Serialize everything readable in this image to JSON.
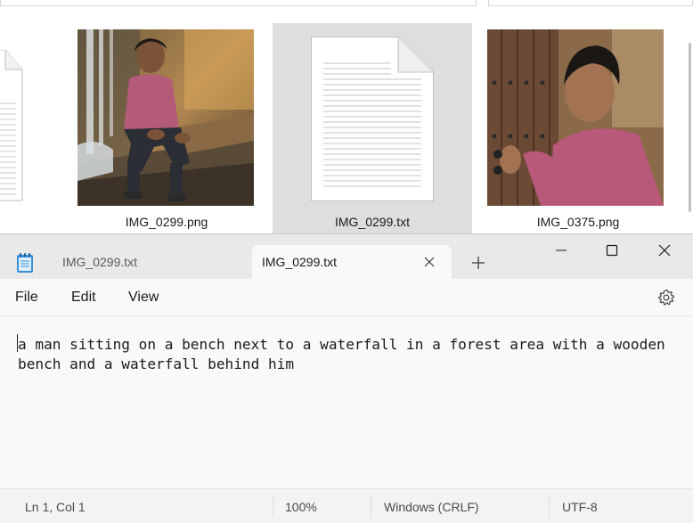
{
  "explorer": {
    "files": [
      {
        "name": "",
        "type": "txt",
        "thumbnail": "doc-icon-partial"
      },
      {
        "name": "IMG_0299.png",
        "type": "png",
        "thumbnail": "photo-man-bench-waterfall"
      },
      {
        "name": "IMG_0299.txt",
        "type": "txt",
        "thumbnail": "doc-icon",
        "selected": true
      },
      {
        "name": "IMG_0375.png",
        "type": "png",
        "thumbnail": "photo-man-wooden-door"
      }
    ]
  },
  "notepad": {
    "app_icon": "notepad-icon",
    "tabs": [
      {
        "label": "IMG_0299.txt",
        "active": false
      },
      {
        "label": "IMG_0299.txt",
        "active": true
      }
    ],
    "new_tab_icon": "plus-icon",
    "window_controls": [
      "minimize-icon",
      "maximize-icon",
      "close-icon"
    ],
    "menu": {
      "file": "File",
      "edit": "Edit",
      "view": "View"
    },
    "settings_icon": "gear-icon",
    "content": "a man sitting on a bench next to a waterfall in a forest area with a wooden bench and a waterfall behind him",
    "status": {
      "position": "Ln 1, Col 1",
      "zoom": "100%",
      "line_ending": "Windows (CRLF)",
      "encoding": "UTF-8"
    }
  },
  "colors": {
    "selected_item_bg": "#dedede",
    "titlebar_bg": "#e9e9e9",
    "editor_bg": "#f9f9f9",
    "statusbar_bg": "#f3f3f3"
  }
}
